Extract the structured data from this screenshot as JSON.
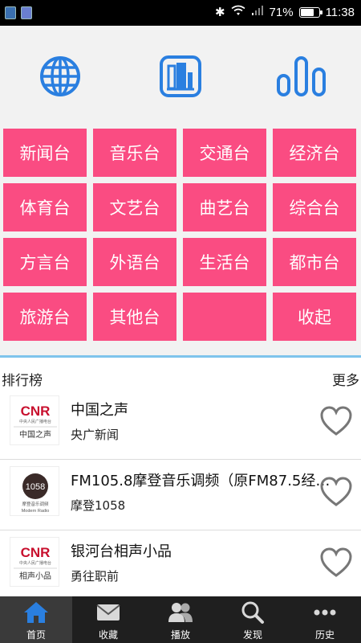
{
  "status": {
    "battery": "71%",
    "time": "11:38"
  },
  "categories": [
    {
      "label": "新闻台"
    },
    {
      "label": "音乐台"
    },
    {
      "label": "交通台"
    },
    {
      "label": "经济台"
    },
    {
      "label": "体育台"
    },
    {
      "label": "文艺台"
    },
    {
      "label": "曲艺台"
    },
    {
      "label": "综合台"
    },
    {
      "label": "方言台"
    },
    {
      "label": "外语台"
    },
    {
      "label": "生活台"
    },
    {
      "label": "都市台"
    },
    {
      "label": "旅游台"
    },
    {
      "label": "其他台"
    },
    {
      "label": ""
    },
    {
      "label": "收起"
    }
  ],
  "ranking": {
    "title": "排行榜",
    "more": "更多",
    "items": [
      {
        "title": "中国之声",
        "subtitle": "央广新闻",
        "logo_text": "中国之声"
      },
      {
        "title": "FM105.8摩登音乐调频（原FM87.5经典…",
        "subtitle": "摩登1058",
        "logo_text": "1058"
      },
      {
        "title": "银河台相声小品",
        "subtitle": "勇往职前",
        "logo_text": "相声小品"
      }
    ]
  },
  "nav": [
    {
      "label": "首页",
      "icon": "home-icon",
      "active": true
    },
    {
      "label": "收藏",
      "icon": "envelope-icon",
      "active": false
    },
    {
      "label": "播放",
      "icon": "people-icon",
      "active": false
    },
    {
      "label": "发现",
      "icon": "search-icon",
      "active": false
    },
    {
      "label": "历史",
      "icon": "more-dots-icon",
      "active": false
    }
  ],
  "colors": {
    "category_bg": "#fa4c82",
    "icon_blue": "#2a7fe0",
    "divider": "#7ec4ec",
    "nav_bg": "#1f1f1f"
  }
}
